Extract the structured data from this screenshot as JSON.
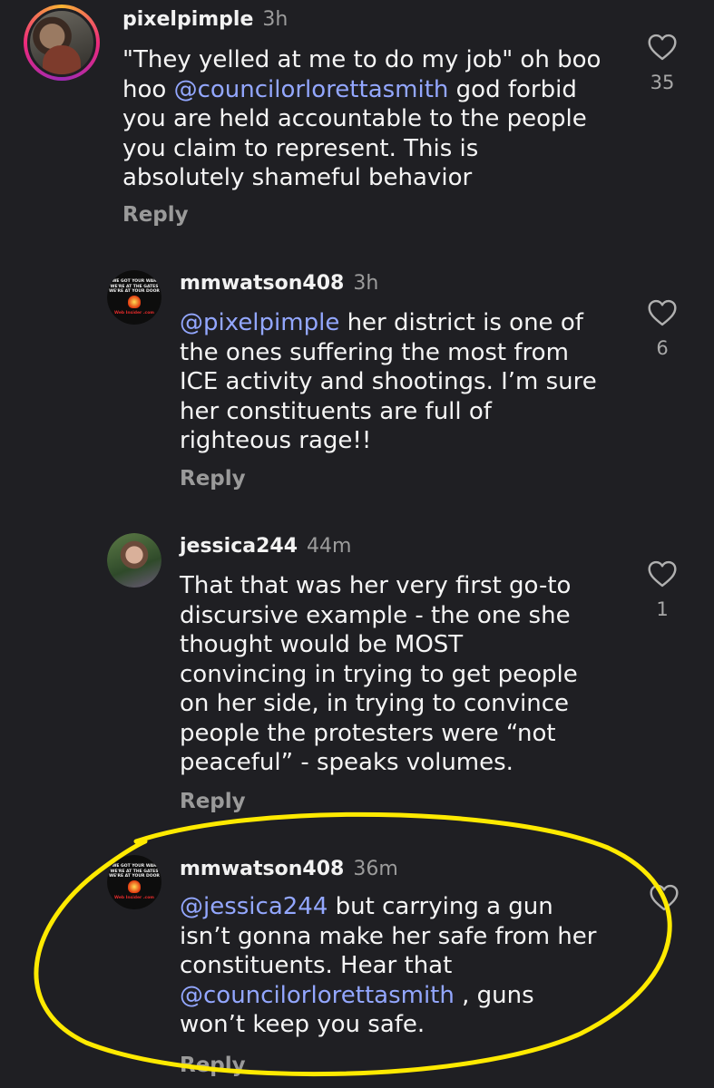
{
  "comments": [
    {
      "username": "pixelpimple",
      "time": "3h",
      "lines": [
        [
          {
            "t": "\"They yelled at me to do my job\" oh boo"
          }
        ],
        [
          {
            "t": "hoo "
          },
          {
            "t": "@councilorlorettasmith",
            "m": true
          },
          {
            "t": " god forbid"
          }
        ],
        [
          {
            "t": "you are held accountable to the people"
          }
        ],
        [
          {
            "t": "you claim to represent. This is"
          }
        ],
        [
          {
            "t": "absolutely shameful behavior"
          }
        ]
      ],
      "reply": "Reply",
      "likes": "35"
    },
    {
      "username": "mmwatson408",
      "time": "3h",
      "lines": [
        [
          {
            "t": "@pixelpimple",
            "m": true
          },
          {
            "t": " her district is one of"
          }
        ],
        [
          {
            "t": "the ones suffering the most from"
          }
        ],
        [
          {
            "t": "ICE activity and shootings. I’m sure"
          }
        ],
        [
          {
            "t": "her constituents are full of"
          }
        ],
        [
          {
            "t": "righteous rage!!"
          }
        ]
      ],
      "reply": "Reply",
      "likes": "6"
    },
    {
      "username": "jessica244",
      "time": "44m",
      "lines": [
        [
          {
            "t": "That that was her very first go-to"
          }
        ],
        [
          {
            "t": "discursive example - the one she"
          }
        ],
        [
          {
            "t": "thought would be MOST"
          }
        ],
        [
          {
            "t": "convincing in trying to get people"
          }
        ],
        [
          {
            "t": "on her side, in trying to convince"
          }
        ],
        [
          {
            "t": "people the protesters were “not"
          }
        ],
        [
          {
            "t": "peaceful” - speaks volumes."
          }
        ]
      ],
      "reply": "Reply",
      "likes": "1"
    },
    {
      "username": "mmwatson408",
      "time": "36m",
      "lines": [
        [
          {
            "t": "@jessica244",
            "m": true
          },
          {
            "t": " but carrying a gun"
          }
        ],
        [
          {
            "t": "isn’t gonna make her safe from her"
          }
        ],
        [
          {
            "t": "constituents. Hear that"
          }
        ],
        [
          {
            "t": "@councilorlorettasmith",
            "m": true
          },
          {
            "t": " , guns"
          }
        ],
        [
          {
            "t": "won’t keep you safe."
          }
        ]
      ],
      "reply": "Reply",
      "likes": ""
    }
  ],
  "avatar_logo_lines": [
    "WE GOT YOUR WAR",
    "WE'RE AT THE GATES",
    "WE'RE AT YOUR DOOR"
  ],
  "avatar_logo_footer": "Web Insider .com",
  "colors": {
    "background": "#1f1f23",
    "mention": "#93a7ff",
    "highlight": "#ffea00",
    "story_ring": [
      "#f9b532",
      "#ee2a7b",
      "#9c2ab5"
    ]
  },
  "icons": {
    "like": "heart-outline-icon"
  }
}
